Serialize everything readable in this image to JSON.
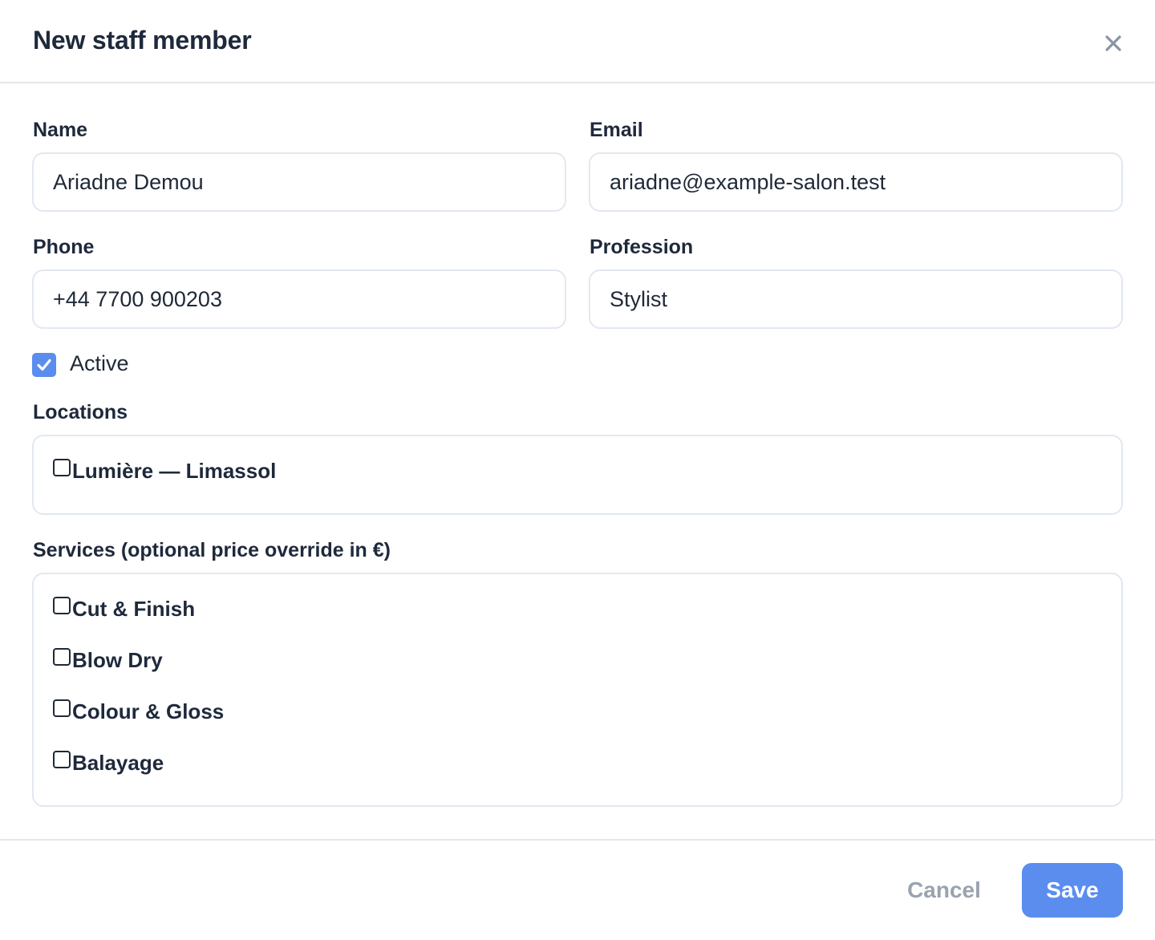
{
  "dialog": {
    "title": "New staff member"
  },
  "form": {
    "name": {
      "label": "Name",
      "value": "Ariadne Demou"
    },
    "email": {
      "label": "Email",
      "value": "ariadne@example-salon.test"
    },
    "phone": {
      "label": "Phone",
      "value": "+44 7700 900203"
    },
    "profession": {
      "label": "Profession",
      "value": "Stylist"
    },
    "active": {
      "label": "Active",
      "checked": true
    },
    "locations": {
      "label": "Locations",
      "items": [
        {
          "label": "Lumière — Limassol",
          "checked": false
        }
      ]
    },
    "services": {
      "label": "Services (optional price override in €)",
      "items": [
        {
          "label": "Cut & Finish",
          "checked": false
        },
        {
          "label": "Blow Dry",
          "checked": false
        },
        {
          "label": "Colour & Gloss",
          "checked": false
        },
        {
          "label": "Balayage",
          "checked": false
        }
      ]
    }
  },
  "footer": {
    "cancel_label": "Cancel",
    "save_label": "Save"
  },
  "colors": {
    "accent": "#5b8def",
    "text": "#1e293b",
    "border": "#e2e8f0",
    "muted": "#9aa3af"
  },
  "icons": {
    "close": "close-icon",
    "check": "checkmark-icon"
  }
}
